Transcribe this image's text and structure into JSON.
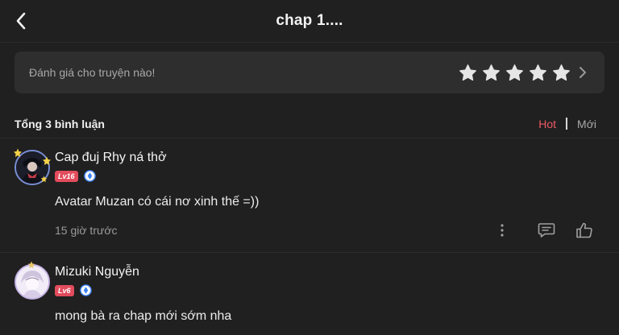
{
  "header": {
    "title": "chap 1....",
    "back_icon": "chevron-left-icon"
  },
  "rating": {
    "prompt": "Đánh giá cho truyện nào!",
    "stars_total": 5,
    "stars_filled": 0,
    "star_color": "#e6e6e6",
    "arrow_icon": "chevron-right-icon"
  },
  "comments_bar": {
    "total_label": "Tổng 3 bình luận",
    "sort_tabs": [
      {
        "label": "Hot",
        "active": true,
        "color": "#ee5a66"
      },
      {
        "label": "Mới",
        "active": false,
        "color": "#a8a8a8"
      }
    ]
  },
  "comments": [
    {
      "username": "Cap đuj Rhy ná thở",
      "level": "Lv16",
      "text": "Avatar Muzan có cái nơ xinh thế =))",
      "time": "15 giờ trước",
      "actions": [
        "more-icon",
        "reply-icon",
        "like-icon"
      ]
    },
    {
      "username": "Mizuki Nguyễn",
      "level": "Lv6",
      "text": "mong bà ra chap mới sớm nha"
    }
  ],
  "colors": {
    "background": "#202020",
    "card": "#2e2e2e",
    "accent": "#ee5a66",
    "level_badge": "#e24c5c",
    "verify": "#3b82f6"
  }
}
